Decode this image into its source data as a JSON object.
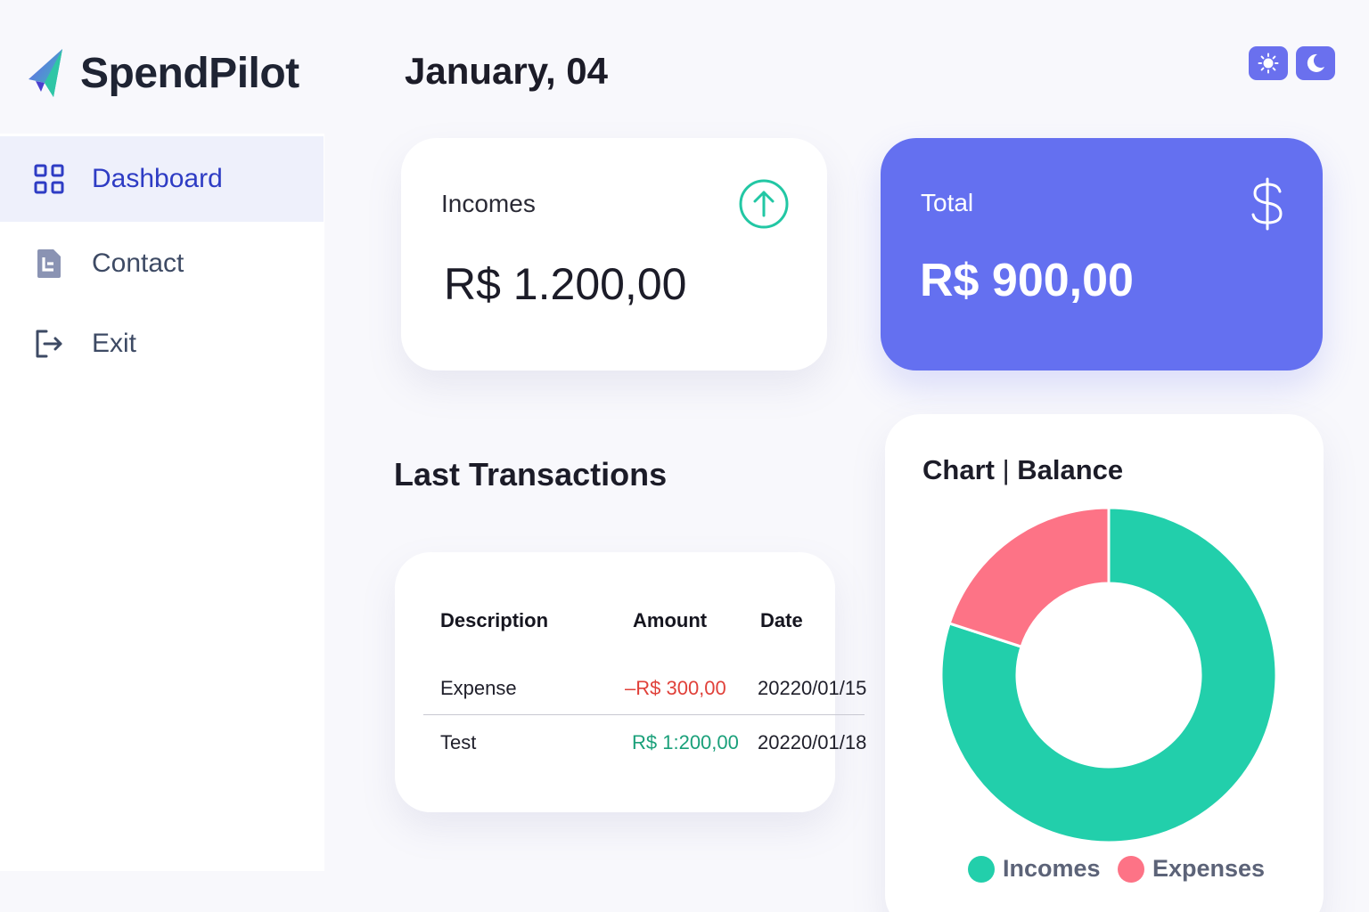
{
  "app": {
    "name": "SpendPilot"
  },
  "sidebar": {
    "items": [
      {
        "label": "Dashboard",
        "icon": "grid-icon",
        "active": true
      },
      {
        "label": "Contact",
        "icon": "document-icon",
        "active": false
      },
      {
        "label": "Exit",
        "icon": "logout-icon",
        "active": false
      }
    ]
  },
  "header": {
    "date": "January, 04",
    "theme_buttons": [
      "sun-icon",
      "moon-icon"
    ]
  },
  "cards": {
    "incomes": {
      "label": "Incomes",
      "value": "R$ 1.200,00",
      "icon": "arrow-up-circle-icon"
    },
    "total": {
      "label": "Total",
      "value": "R$ 900,00",
      "icon": "dollar-icon"
    }
  },
  "transactions": {
    "title": "Last Transactions",
    "columns": [
      "Description",
      "Amount",
      "Date"
    ],
    "rows": [
      {
        "description": "Expense",
        "amount": "–R$ 300,00",
        "date": "20220/01/15",
        "kind": "expense"
      },
      {
        "description": "Test",
        "amount": "R$ 1:200,00",
        "date": "20220/01/18",
        "kind": "income"
      }
    ]
  },
  "chart": {
    "title_left": "Chart",
    "title_sep": "|",
    "title_right": "Balance"
  },
  "chart_data": {
    "type": "pie",
    "donut": true,
    "title": "Chart | Balance",
    "categories": [
      "Incomes",
      "Expenses"
    ],
    "values": [
      1200,
      300
    ],
    "colors": [
      "#22cfab",
      "#fd7386"
    ],
    "legend_position": "bottom"
  },
  "colors": {
    "accent": "#6470f0",
    "income": "#22cfab",
    "expense": "#fd7386",
    "negative_text": "#e0413a",
    "positive_text": "#1aa07a"
  }
}
